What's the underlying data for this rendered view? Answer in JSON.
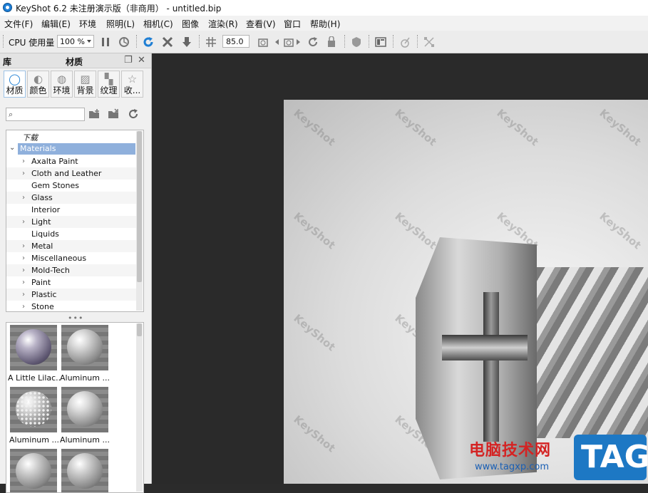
{
  "window": {
    "title": "KeyShot 6.2 未注册演示版（非商用） - untitled.bip"
  },
  "menu": [
    "文件(F)",
    "编辑(E)",
    "环境",
    "照明(L)",
    "相机(C)",
    "图像",
    "渲染(R)",
    "查看(V)",
    "窗口",
    "帮助(H)"
  ],
  "toolbar": {
    "cpu_label": "CPU 使用量",
    "zoom": "100 %",
    "value": "85.0"
  },
  "library": {
    "header_left": "库",
    "header_title": "材质",
    "tabs": [
      "材质",
      "颜色",
      "环境",
      "背景",
      "纹理",
      "收..."
    ],
    "search_placeholder": "",
    "tree": {
      "downloads": "下载",
      "root": "Materials",
      "items": [
        "Axalta Paint",
        "Cloth and Leather",
        "Gem Stones",
        "Glass",
        "Interior",
        "Light",
        "Liquids",
        "Metal",
        "Miscellaneous",
        "Mold-Tech",
        "Paint",
        "Plastic",
        "Stone"
      ]
    },
    "thumbnails": [
      "A Little Lilac...",
      "Aluminum ...",
      "Aluminum ...",
      "Aluminum ...",
      "",
      ""
    ]
  },
  "viewport": {
    "watermark": "KeyShot",
    "brand_cn": "电脑技术网",
    "brand_url": "www.tagxp.com",
    "brand_tag": "TAG"
  },
  "colors": {
    "accent": "#1f7fd4",
    "selection": "#8fb0dc",
    "viewport_bg": "#2a2a2a",
    "brand_red": "#d42323",
    "brand_blue": "#1d78c4"
  }
}
